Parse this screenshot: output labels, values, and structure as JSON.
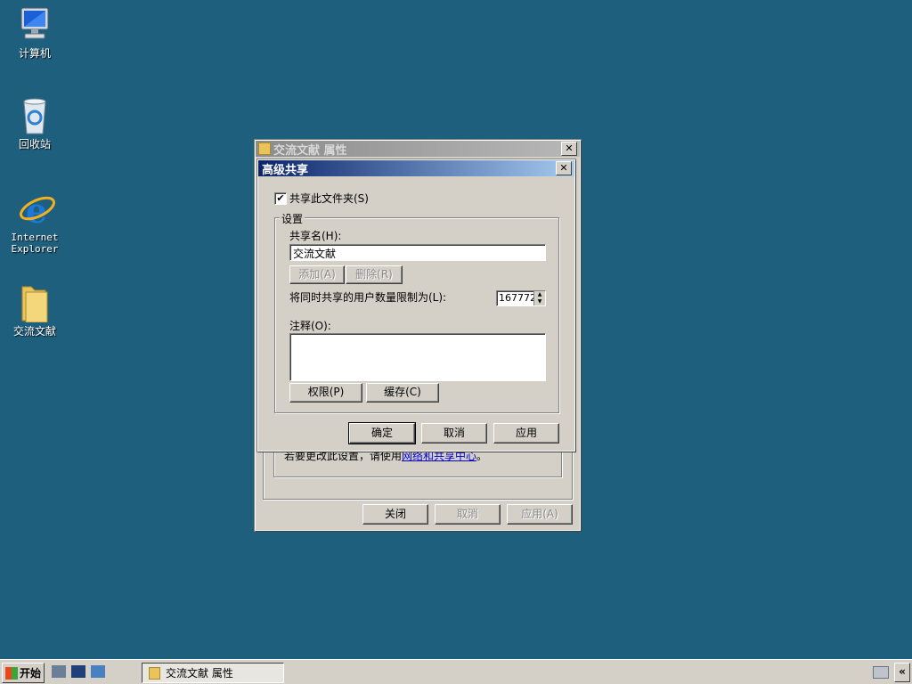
{
  "desktop": {
    "icons": [
      {
        "label": "计算机"
      },
      {
        "label": "回收站"
      },
      {
        "label": "Internet\nExplorer"
      },
      {
        "label": "交流文献"
      }
    ]
  },
  "props_window": {
    "title": "交流文献  属性",
    "hint_text": "若要更改此设置，请使用",
    "hint_link": "网络和共享中心",
    "hint_suffix": "。",
    "buttons": {
      "close": "关闭",
      "cancel": "取消",
      "apply": "应用(A)"
    }
  },
  "advanced_dialog": {
    "title": "高级共享",
    "share_checkbox": {
      "label": "共享此文件夹(S)",
      "checked": true
    },
    "settings_group": "设置",
    "share_name_label": "共享名(H):",
    "share_name_value": "交流文献",
    "add_button": "添加(A)",
    "remove_button": "删除(R)",
    "user_limit_label": "将同时共享的用户数量限制为(L):",
    "user_limit_value": "167772",
    "comment_label": "注释(O):",
    "comment_value": "",
    "permissions_button": "权限(P)",
    "cache_button": "缓存(C)",
    "ok_button": "确定",
    "cancel_button": "取消",
    "apply_button": "应用"
  },
  "taskbar": {
    "start_label": "开始",
    "task_label": "交流文献  属性"
  }
}
